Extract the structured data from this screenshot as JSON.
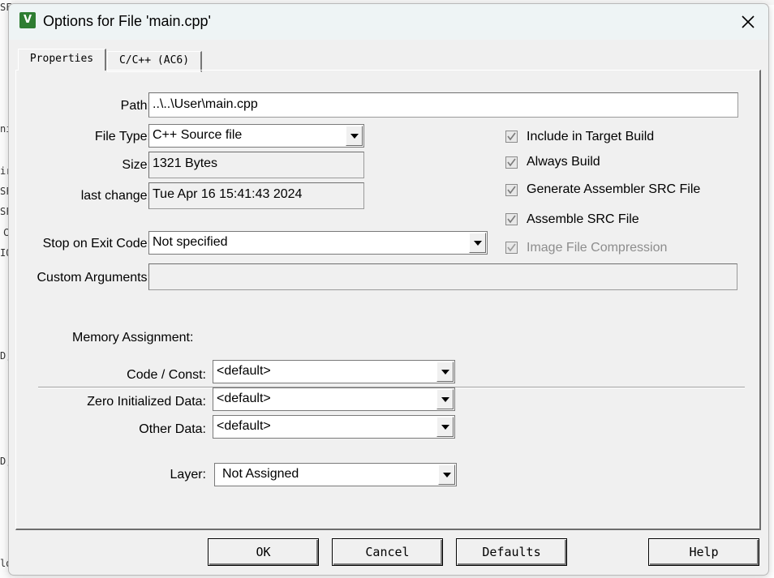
{
  "window": {
    "title": "Options for File 'main.cpp'",
    "icon": "keil-uvision-icon"
  },
  "tabs": [
    {
      "label": "Properties",
      "active": true
    },
    {
      "label": "C/C++ (AC6)",
      "active": false
    }
  ],
  "properties": {
    "path_label": "Path:",
    "path_value": "..\\..\\User\\main.cpp",
    "file_type_label": "File Type:",
    "file_type_value": "C++ Source file",
    "size_label": "Size:",
    "size_value": "1321 Bytes",
    "last_change_label": "last change:",
    "last_change_value": "Tue Apr 16 15:41:43 2024",
    "stop_label": "Stop on Exit Code:",
    "stop_value": "Not specified",
    "custom_label": "Custom Arguments:",
    "custom_value": ""
  },
  "checkboxes": [
    {
      "label": "Include in Target Build",
      "checked": true,
      "enabled": true
    },
    {
      "label": "Always Build",
      "checked": true,
      "enabled": true
    },
    {
      "label": "Generate Assembler SRC File",
      "checked": true,
      "enabled": true
    },
    {
      "label": "Assemble SRC File",
      "checked": true,
      "enabled": true
    },
    {
      "label": "Image File Compression",
      "checked": true,
      "enabled": false
    }
  ],
  "memory": {
    "heading": "Memory Assignment:",
    "code_label": "Code / Const:",
    "code_value": "<default>",
    "zero_label": "Zero Initialized Data:",
    "zero_value": "<default>",
    "other_label": "Other Data:",
    "other_value": "<default>",
    "layer_label": "Layer:",
    "layer_value": "Not Assigned"
  },
  "buttons": {
    "ok": "OK",
    "cancel": "Cancel",
    "defaults": "Defaults",
    "help": "Help"
  },
  "background_code_fragments": [
    "SF",
    "ni",
    "ir",
    "SF",
    "SF",
    "C",
    "IO",
    "D,",
    "D,",
    "ld"
  ],
  "colors": {
    "checkmark": "#7a7a7a",
    "icon_bg": "#2e7d32"
  }
}
